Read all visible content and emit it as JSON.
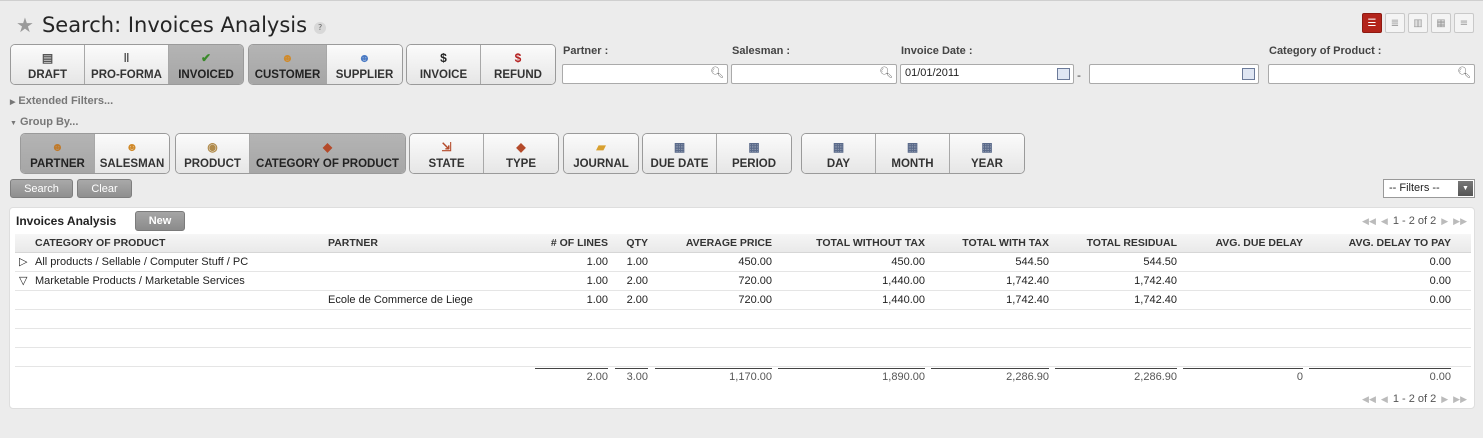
{
  "header": {
    "title": "Search: Invoices Analysis",
    "help": "?"
  },
  "views": [
    "list-view",
    "form-view",
    "graph-view",
    "calendar-view",
    "gantt-view"
  ],
  "filters_row1": [
    {
      "group": "state",
      "buttons": [
        {
          "label": "DRAFT",
          "icon": "draft-icon",
          "on": false
        },
        {
          "label": "PRO-FORMA",
          "icon": "pause-icon",
          "on": false
        },
        {
          "label": "INVOICED",
          "icon": "check-icon",
          "on": true
        }
      ]
    },
    {
      "group": "partner-type",
      "buttons": [
        {
          "label": "CUSTOMER",
          "icon": "customer-icon",
          "on": true
        },
        {
          "label": "SUPPLIER",
          "icon": "supplier-icon",
          "on": false
        }
      ]
    },
    {
      "group": "invoice-type",
      "buttons": [
        {
          "label": "INVOICE",
          "icon": "dollar-icon",
          "on": false
        },
        {
          "label": "REFUND",
          "icon": "refund-icon",
          "on": false
        }
      ]
    }
  ],
  "fields": {
    "partner": {
      "label": "Partner :",
      "value": ""
    },
    "salesman": {
      "label": "Salesman :",
      "value": ""
    },
    "invoice_date": {
      "label": "Invoice Date :",
      "from": "01/01/2011",
      "to": "",
      "separator": "-"
    },
    "category": {
      "label": "Category of Product :",
      "value": ""
    }
  },
  "extended_filters": "Extended Filters...",
  "group_by": {
    "label": "Group By...",
    "groups": [
      [
        {
          "label": "PARTNER",
          "icon": "partner-icon",
          "on": true
        },
        {
          "label": "SALESMAN",
          "icon": "salesman-icon",
          "on": false
        }
      ],
      [
        {
          "label": "PRODUCT",
          "icon": "product-icon",
          "on": false
        },
        {
          "label": "CATEGORY OF PRODUCT",
          "icon": "category-icon",
          "on": true
        }
      ],
      [
        {
          "label": "STATE",
          "icon": "state-icon",
          "on": false
        },
        {
          "label": "TYPE",
          "icon": "type-icon",
          "on": false
        }
      ],
      [
        {
          "label": "JOURNAL",
          "icon": "journal-icon",
          "on": false
        }
      ],
      [
        {
          "label": "DUE DATE",
          "icon": "calendar-icon",
          "on": false
        },
        {
          "label": "PERIOD",
          "icon": "calendar-icon",
          "on": false
        }
      ],
      [
        {
          "label": "DAY",
          "icon": "calendar-icon",
          "on": false
        },
        {
          "label": "MONTH",
          "icon": "calendar-icon",
          "on": false
        },
        {
          "label": "YEAR",
          "icon": "calendar-icon",
          "on": false
        }
      ]
    ]
  },
  "actions": {
    "search": "Search",
    "clear": "Clear",
    "filters": "-- Filters --"
  },
  "list": {
    "title": "Invoices Analysis",
    "new_label": "New",
    "pager": "1 - 2 of 2",
    "columns": [
      "CATEGORY OF PRODUCT",
      "PARTNER",
      "# OF LINES",
      "QTY",
      "AVERAGE PRICE",
      "TOTAL WITHOUT TAX",
      "TOTAL WITH TAX",
      "TOTAL RESIDUAL",
      "AVG. DUE DELAY",
      "AVG. DELAY TO PAY"
    ],
    "rows": [
      {
        "toggle": "▷",
        "cells": [
          "All products / Sellable / Computer Stuff / PC",
          "",
          "1.00",
          "1.00",
          "450.00",
          "450.00",
          "544.50",
          "544.50",
          "",
          "0.00"
        ]
      },
      {
        "toggle": "▽",
        "cells": [
          "Marketable Products / Marketable Services",
          "",
          "1.00",
          "2.00",
          "720.00",
          "1,440.00",
          "1,742.40",
          "1,742.40",
          "",
          "0.00"
        ]
      },
      {
        "toggle": "",
        "cells": [
          "",
          "Ecole de Commerce de Liege",
          "1.00",
          "2.00",
          "720.00",
          "1,440.00",
          "1,742.40",
          "1,742.40",
          "",
          "0.00"
        ]
      },
      {
        "toggle": "",
        "cells": [
          "",
          "",
          "",
          "",
          "",
          "",
          "",
          "",
          "",
          ""
        ]
      },
      {
        "toggle": "",
        "cells": [
          "",
          "",
          "",
          "",
          "",
          "",
          "",
          "",
          "",
          ""
        ]
      },
      {
        "toggle": "",
        "cells": [
          "",
          "",
          "",
          "",
          "",
          "",
          "",
          "",
          "",
          ""
        ]
      }
    ],
    "totals": [
      "",
      "",
      "2.00",
      "3.00",
      "1,170.00",
      "1,890.00",
      "2,286.90",
      "2,286.90",
      "0",
      "0.00"
    ]
  }
}
